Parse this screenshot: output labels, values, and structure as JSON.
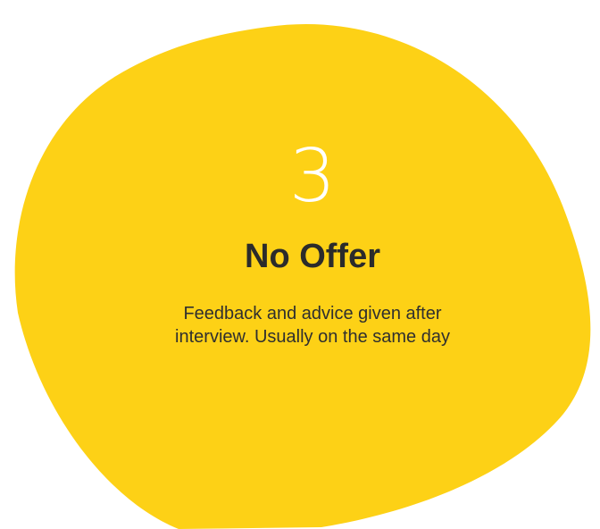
{
  "step": {
    "number": "3",
    "title": "No Offer",
    "description": "Feedback and advice given after interview. Usually on the same day"
  },
  "colors": {
    "blob": "#fdd116",
    "number": "#ffffff",
    "text": "#2b2b2b",
    "background": "#ffffff"
  }
}
